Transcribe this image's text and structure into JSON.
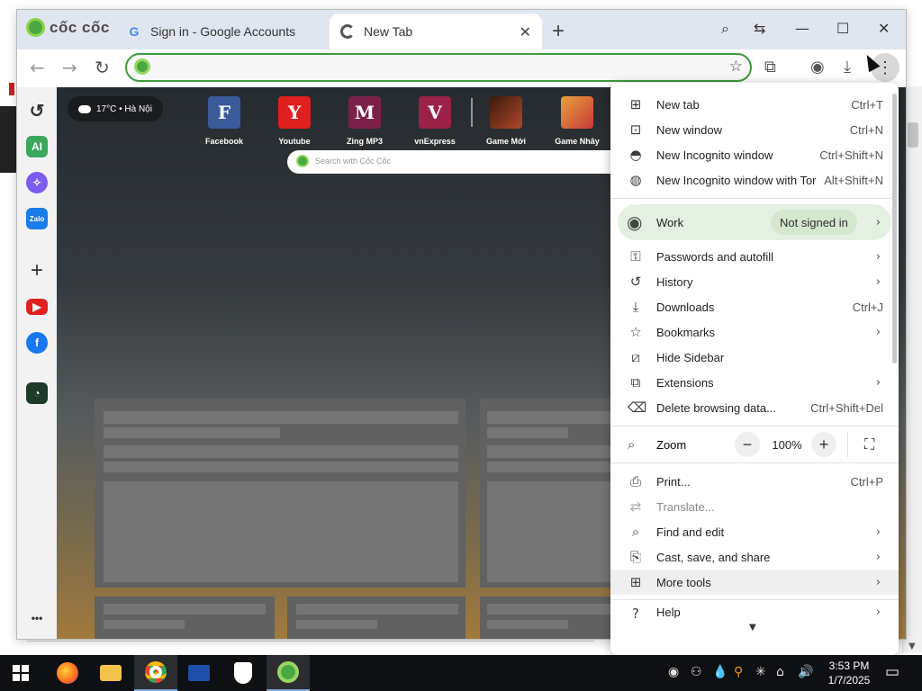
{
  "browser": {
    "brand": "cốc cốc",
    "tabs": [
      {
        "title": "Sign in - Google Accounts",
        "icon": "google-icon"
      },
      {
        "title": "New Tab",
        "icon": "coccoc-icon"
      }
    ],
    "omnibox": {
      "value": "",
      "placeholder": ""
    }
  },
  "sidebar": {
    "items": [
      "history-icon",
      "ai-assistant-icon",
      "messenger-icon",
      "zalo-icon",
      "add-icon",
      "youtube-icon",
      "facebook-icon",
      "coccoc-2024-icon",
      "more-icon"
    ],
    "ai_label": "AI",
    "zalo_label": "Zalo",
    "add_label": "+",
    "more_label": "•••"
  },
  "new_tab": {
    "weather": "17°C • Hà Nội",
    "search_placeholder": "Search with Cốc Cốc",
    "speed_dial": [
      {
        "label": "Facebook",
        "letter": "F",
        "color": "#3b5a9a"
      },
      {
        "label": "Youtube",
        "letter": "Y",
        "color": "#e01f1f"
      },
      {
        "label": "Zing MP3",
        "letter": "M",
        "color": "#7b2149"
      },
      {
        "label": "vnExpress",
        "letter": "V",
        "color": "#9b2149"
      },
      {
        "label": "Game Mới",
        "letter": "",
        "color": "#7a2a14"
      },
      {
        "label": "Game Nhây",
        "letter": "",
        "color": "#d46a2c"
      }
    ]
  },
  "menu": {
    "items": [
      {
        "label": "New tab",
        "shortcut": "Ctrl+T",
        "icon": "new-tab-icon"
      },
      {
        "label": "New window",
        "shortcut": "Ctrl+N",
        "icon": "new-window-icon"
      },
      {
        "label": "New Incognito window",
        "shortcut": "Ctrl+Shift+N",
        "icon": "incognito-icon"
      },
      {
        "label": "New Incognito window with Tor",
        "shortcut": "Alt+Shift+N",
        "icon": "tor-globe-icon"
      }
    ],
    "profile": {
      "name": "Work",
      "status": "Not signed in"
    },
    "items2": [
      {
        "label": "Passwords and autofill",
        "icon": "key-icon"
      },
      {
        "label": "History",
        "icon": "history-icon"
      },
      {
        "label": "Downloads",
        "shortcut": "Ctrl+J",
        "icon": "download-icon"
      },
      {
        "label": "Bookmarks",
        "icon": "star-icon"
      },
      {
        "label": "Hide Sidebar",
        "icon": "hide-sidebar-icon"
      },
      {
        "label": "Extensions",
        "icon": "extension-icon"
      },
      {
        "label": "Delete browsing data...",
        "shortcut": "Ctrl+Shift+Del",
        "icon": "trash-icon"
      }
    ],
    "zoom": {
      "label": "Zoom",
      "value": "100%"
    },
    "items3": [
      {
        "label": "Print...",
        "shortcut": "Ctrl+P",
        "icon": "print-icon"
      },
      {
        "label": "Translate...",
        "icon": "translate-icon",
        "disabled": true
      },
      {
        "label": "Find and edit",
        "icon": "search-icon"
      },
      {
        "label": "Cast, save, and share",
        "icon": "cast-icon"
      },
      {
        "label": "More tools",
        "icon": "tools-icon"
      },
      {
        "label": "Help",
        "icon": "help-icon"
      }
    ]
  },
  "taskbar": {
    "time": "3:53 PM",
    "date": "1/7/2025"
  },
  "colors": {
    "accent": "#3e9a3b",
    "menu_profile_bg": "#e4f1e2"
  }
}
